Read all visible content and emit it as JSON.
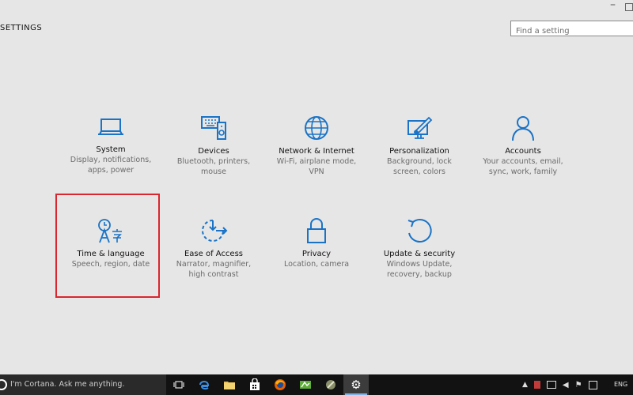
{
  "window": {
    "title": "SETTINGS"
  },
  "search": {
    "placeholder": "Find a setting"
  },
  "tiles": [
    {
      "name": "System",
      "desc1": "Display, notifications,",
      "desc2": "apps, power",
      "icon": "laptop-icon"
    },
    {
      "name": "Devices",
      "desc1": "Bluetooth, printers,",
      "desc2": "mouse",
      "icon": "devices-icon"
    },
    {
      "name": "Network & Internet",
      "desc1": "Wi-Fi, airplane mode,",
      "desc2": "VPN",
      "icon": "globe-icon"
    },
    {
      "name": "Personalization",
      "desc1": "Background, lock",
      "desc2": "screen, colors",
      "icon": "personalization-icon"
    },
    {
      "name": "Accounts",
      "desc1": "Your accounts, email,",
      "desc2": "sync, work, family",
      "icon": "person-icon"
    },
    {
      "name": "Time & language",
      "desc1": "Speech, region, date",
      "desc2": "",
      "icon": "time-language-icon"
    },
    {
      "name": "Ease of Access",
      "desc1": "Narrator, magnifier,",
      "desc2": "high contrast",
      "icon": "ease-of-access-icon"
    },
    {
      "name": "Privacy",
      "desc1": "Location, camera",
      "desc2": "",
      "icon": "lock-icon"
    },
    {
      "name": "Update & security",
      "desc1": "Windows Update,",
      "desc2": "recovery, backup",
      "icon": "update-icon"
    }
  ],
  "taskbar": {
    "cortana_text": "I'm Cortana. Ask me anything.",
    "language": "ENG"
  },
  "colors": {
    "accent": "#1a73c6",
    "highlight": "#d9262f",
    "background": "#e6e6e6"
  }
}
